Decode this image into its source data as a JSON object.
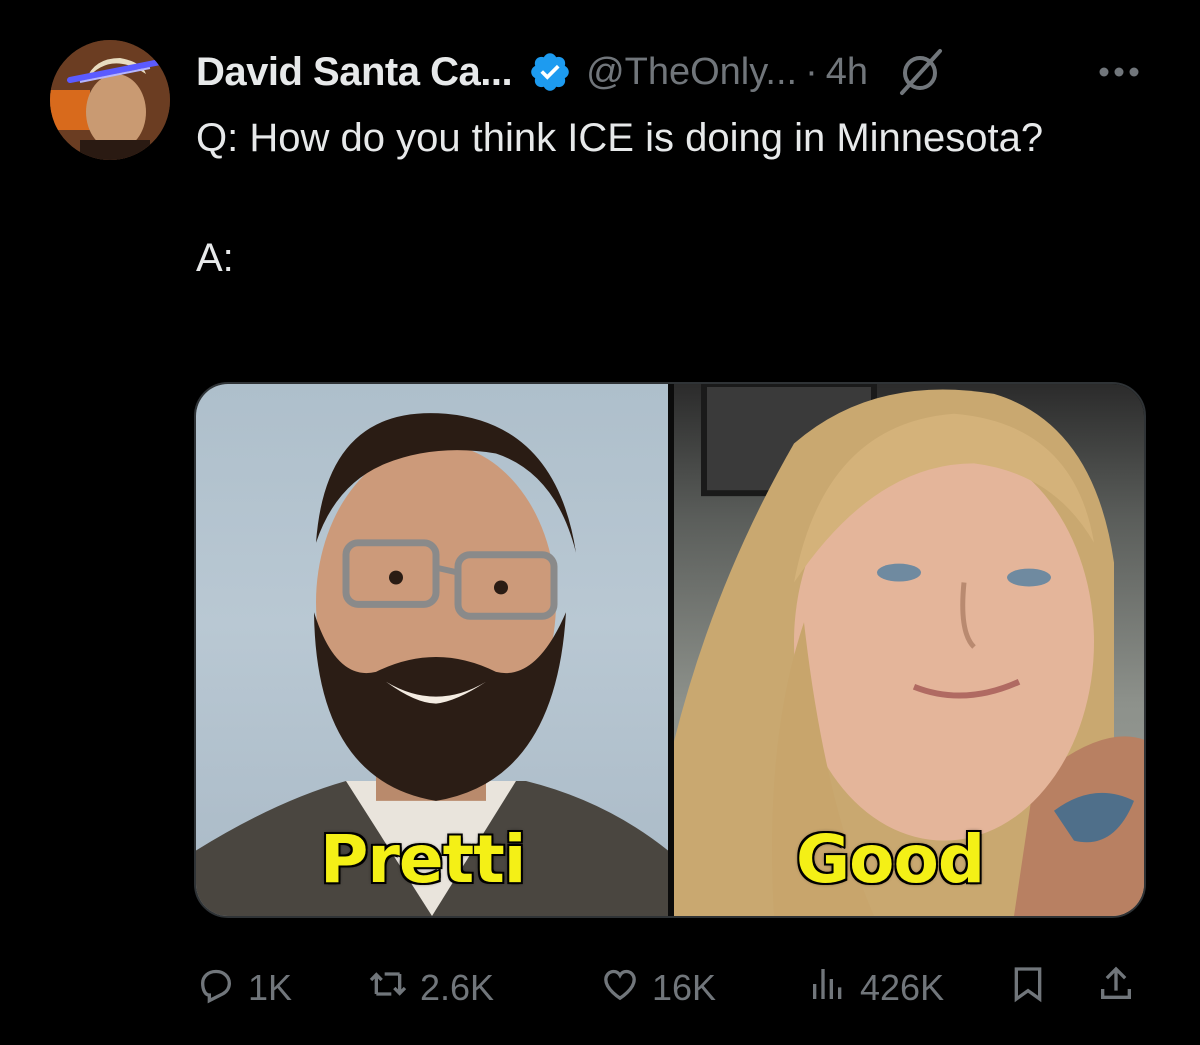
{
  "author": {
    "display_name": "David Santa Ca...",
    "handle": "@TheOnly...",
    "separator": "·",
    "time": "4h",
    "verified_color": "#1d9bf0"
  },
  "tweet": {
    "question": "Q: How do you think ICE is doing in Minnesota?",
    "answer": "A:"
  },
  "media": {
    "left_caption": "Pretti",
    "right_caption": "Good",
    "caption_color": "#f4f016"
  },
  "actions": {
    "replies": "1K",
    "reposts": "2.6K",
    "likes": "16K",
    "views": "426K"
  },
  "icons": {
    "avatar": "avatar",
    "verified": "verified-badge-icon",
    "grok": "grok-icon",
    "more": "more-icon",
    "reply": "reply-icon",
    "repost": "repost-icon",
    "like": "heart-icon",
    "views": "views-icon",
    "bookmark": "bookmark-icon",
    "share": "share-icon"
  },
  "colors": {
    "background": "#000000",
    "text": "#e7e9ea",
    "muted": "#71767b"
  }
}
